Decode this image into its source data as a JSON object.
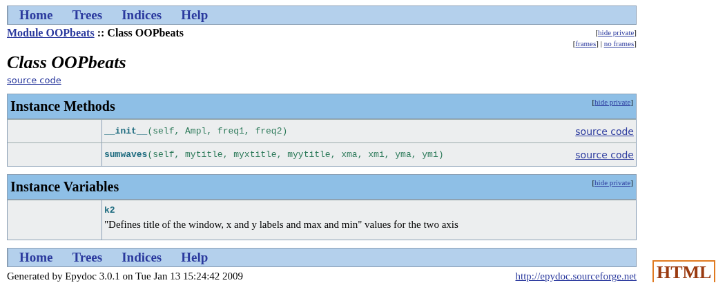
{
  "top_nav": [
    {
      "label": "Home"
    },
    {
      "label": "Trees"
    },
    {
      "label": "Indices"
    },
    {
      "label": "Help"
    }
  ],
  "breadcrumb": [
    {
      "kind": "link",
      "text": "Module OOPbeats"
    },
    {
      "kind": "text",
      "text": " :: Class OOPbeats"
    }
  ],
  "top_links": [
    [
      {
        "kind": "text",
        "text": "["
      },
      {
        "kind": "link",
        "text": "hide private"
      },
      {
        "kind": "text",
        "text": "]"
      }
    ],
    [
      {
        "kind": "text",
        "text": "["
      },
      {
        "kind": "link",
        "text": "frames"
      },
      {
        "kind": "text",
        "text": "] | "
      },
      {
        "kind": "link",
        "text": "no frames"
      },
      {
        "kind": "text",
        "text": "]"
      }
    ]
  ],
  "title": "Class OOPbeats",
  "source_link": "source code",
  "sections": [
    {
      "title": "Instance Methods",
      "toggle": [
        {
          "kind": "text",
          "text": "["
        },
        {
          "kind": "link",
          "text": "hide private"
        },
        {
          "kind": "text",
          "text": "]"
        }
      ],
      "rows": [
        {
          "kind": "method",
          "name": "__init__",
          "params": "(self, Ampl, freq1, freq2)",
          "link": "source code"
        },
        {
          "kind": "method",
          "name": "sumwaves",
          "params": "(self, mytitle, myxtitle, myytitle, xma, xmi, yma, ymi)",
          "link": "source code"
        }
      ]
    },
    {
      "title": "Instance Variables",
      "toggle": [
        {
          "kind": "text",
          "text": "["
        },
        {
          "kind": "link",
          "text": "hide private"
        },
        {
          "kind": "text",
          "text": "]"
        }
      ],
      "rows": [
        {
          "kind": "variable",
          "name": "k2",
          "description": "\"Defines title of the window, x and y labels and max and min\" values for the two axis"
        }
      ]
    }
  ],
  "bottom_nav": [
    {
      "label": "Home"
    },
    {
      "label": "Trees"
    },
    {
      "label": "Indices"
    },
    {
      "label": "Help"
    }
  ],
  "footer": {
    "generated": "Generated by Epydoc 3.0.1 on Tue Jan 13 15:24:42 2009",
    "link": "http://epydoc.sourceforge.net"
  },
  "badge": "HTML"
}
